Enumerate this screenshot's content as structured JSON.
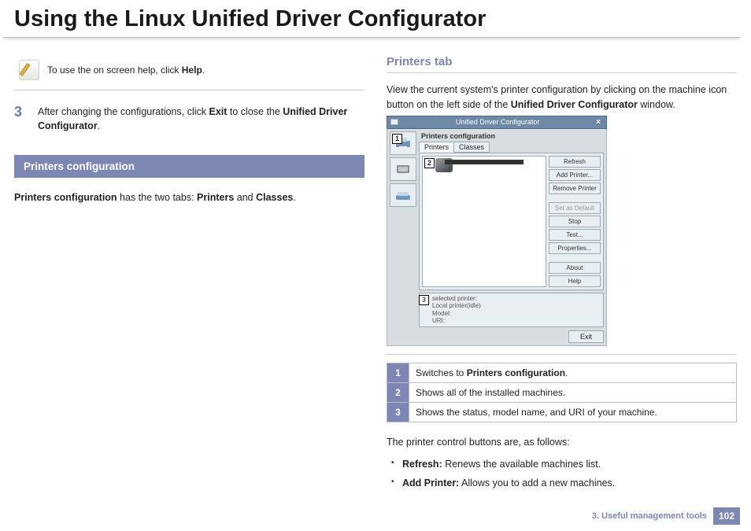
{
  "title": "Using the Linux Unified Driver Configurator",
  "note": {
    "pre": "To use the on screen help, click ",
    "bold": "Help",
    "post": "."
  },
  "step": {
    "num": "3",
    "t1": "After changing the configurations, click ",
    "b1": "Exit",
    "t2": " to close the ",
    "b2": "Unified Driver Configurator",
    "t3": "."
  },
  "section_bar": "Printers configuration",
  "pc_line": {
    "b1": "Printers configuration",
    "t1": " has the two tabs: ",
    "b2": "Printers",
    "t2": " and ",
    "b3": "Classes",
    "t3": "."
  },
  "subhead": "Printers tab",
  "intro": {
    "t1": "View the current system's printer configuration by clicking on the machine icon button on the left side of the ",
    "b1": "Unified Driver Configurator",
    "t2": " window."
  },
  "shot": {
    "titlebar": "Unified Driver Configurator",
    "header": "Printers configuration",
    "tabs": [
      "Printers",
      "Classes"
    ],
    "callouts": [
      "1",
      "2",
      "3"
    ],
    "buttons": [
      "Refresh",
      "Add Printer...",
      "Remove Printer",
      "Set as Default",
      "Stop",
      "Test...",
      "Properties...",
      "About",
      "Help"
    ],
    "status": {
      "h": "selected printer:",
      "l1": "Local printer(idle)",
      "l2": "Model:",
      "l3": "URI:"
    },
    "exit": "Exit"
  },
  "table": [
    {
      "n": "1",
      "pre": "Switches to ",
      "b": "Printers configuration",
      "post": "."
    },
    {
      "n": "2",
      "pre": "Shows all of the installed machines.",
      "b": "",
      "post": ""
    },
    {
      "n": "3",
      "pre": "Shows the status, model name, and URI of your machine.",
      "b": "",
      "post": ""
    }
  ],
  "controls_intro": "The printer control buttons are, as follows:",
  "bullets": [
    {
      "b": "Refresh:",
      "t": " Renews the available machines list."
    },
    {
      "b": "Add Printer:",
      "t": " Allows you to add a new machines."
    }
  ],
  "footer": {
    "chapter": "3.  Useful management tools",
    "page": "102"
  }
}
